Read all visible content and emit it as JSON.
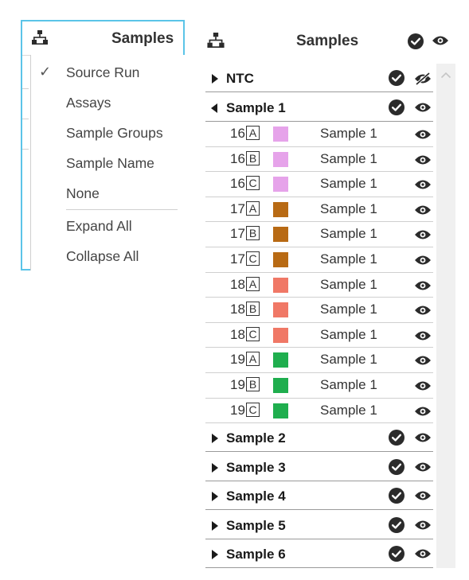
{
  "left_panel": {
    "title": "Samples",
    "icon": "hierarchy-icon",
    "menu": {
      "items": [
        {
          "label": "Source Run",
          "checked": true
        },
        {
          "label": "Assays",
          "checked": false
        },
        {
          "label": "Sample Groups",
          "checked": false
        },
        {
          "label": "Sample Name",
          "checked": false
        },
        {
          "label": "None",
          "checked": false
        },
        {
          "label": "Expand All",
          "checked": false
        },
        {
          "label": "Collapse All",
          "checked": false
        }
      ],
      "check_glyph": "✓"
    }
  },
  "right_panel": {
    "title": "Samples",
    "icon": "hierarchy-icon",
    "groups": [
      {
        "label": "NTC",
        "expanded": false,
        "selected": true,
        "visible": false,
        "samples": []
      },
      {
        "label": "Sample 1",
        "expanded": true,
        "selected": true,
        "visible": true,
        "samples": [
          {
            "well_number": "16",
            "well_letter": "A",
            "color": "#e6a3ea",
            "name": "Sample 1"
          },
          {
            "well_number": "16",
            "well_letter": "B",
            "color": "#e6a3ea",
            "name": "Sample 1"
          },
          {
            "well_number": "16",
            "well_letter": "C",
            "color": "#e6a3ea",
            "name": "Sample 1"
          },
          {
            "well_number": "17",
            "well_letter": "A",
            "color": "#b86a14",
            "name": "Sample 1"
          },
          {
            "well_number": "17",
            "well_letter": "B",
            "color": "#b86a14",
            "name": "Sample 1"
          },
          {
            "well_number": "17",
            "well_letter": "C",
            "color": "#b86a14",
            "name": "Sample 1"
          },
          {
            "well_number": "18",
            "well_letter": "A",
            "color": "#f07866",
            "name": "Sample 1"
          },
          {
            "well_number": "18",
            "well_letter": "B",
            "color": "#f07866",
            "name": "Sample 1"
          },
          {
            "well_number": "18",
            "well_letter": "C",
            "color": "#f07866",
            "name": "Sample 1"
          },
          {
            "well_number": "19",
            "well_letter": "A",
            "color": "#1fae4e",
            "name": "Sample 1"
          },
          {
            "well_number": "19",
            "well_letter": "B",
            "color": "#1fae4e",
            "name": "Sample 1"
          },
          {
            "well_number": "19",
            "well_letter": "C",
            "color": "#1fae4e",
            "name": "Sample 1"
          }
        ]
      },
      {
        "label": "Sample 2",
        "expanded": false,
        "selected": true,
        "visible": true,
        "samples": []
      },
      {
        "label": "Sample 3",
        "expanded": false,
        "selected": true,
        "visible": true,
        "samples": []
      },
      {
        "label": "Sample 4",
        "expanded": false,
        "selected": true,
        "visible": true,
        "samples": []
      },
      {
        "label": "Sample 5",
        "expanded": false,
        "selected": true,
        "visible": true,
        "samples": []
      },
      {
        "label": "Sample 6",
        "expanded": false,
        "selected": true,
        "visible": true,
        "samples": []
      }
    ]
  },
  "colors": {
    "focus_border": "#5bc4e8",
    "icon_dark": "#2b2b2b",
    "scrollbar": "#f0f0f0"
  }
}
